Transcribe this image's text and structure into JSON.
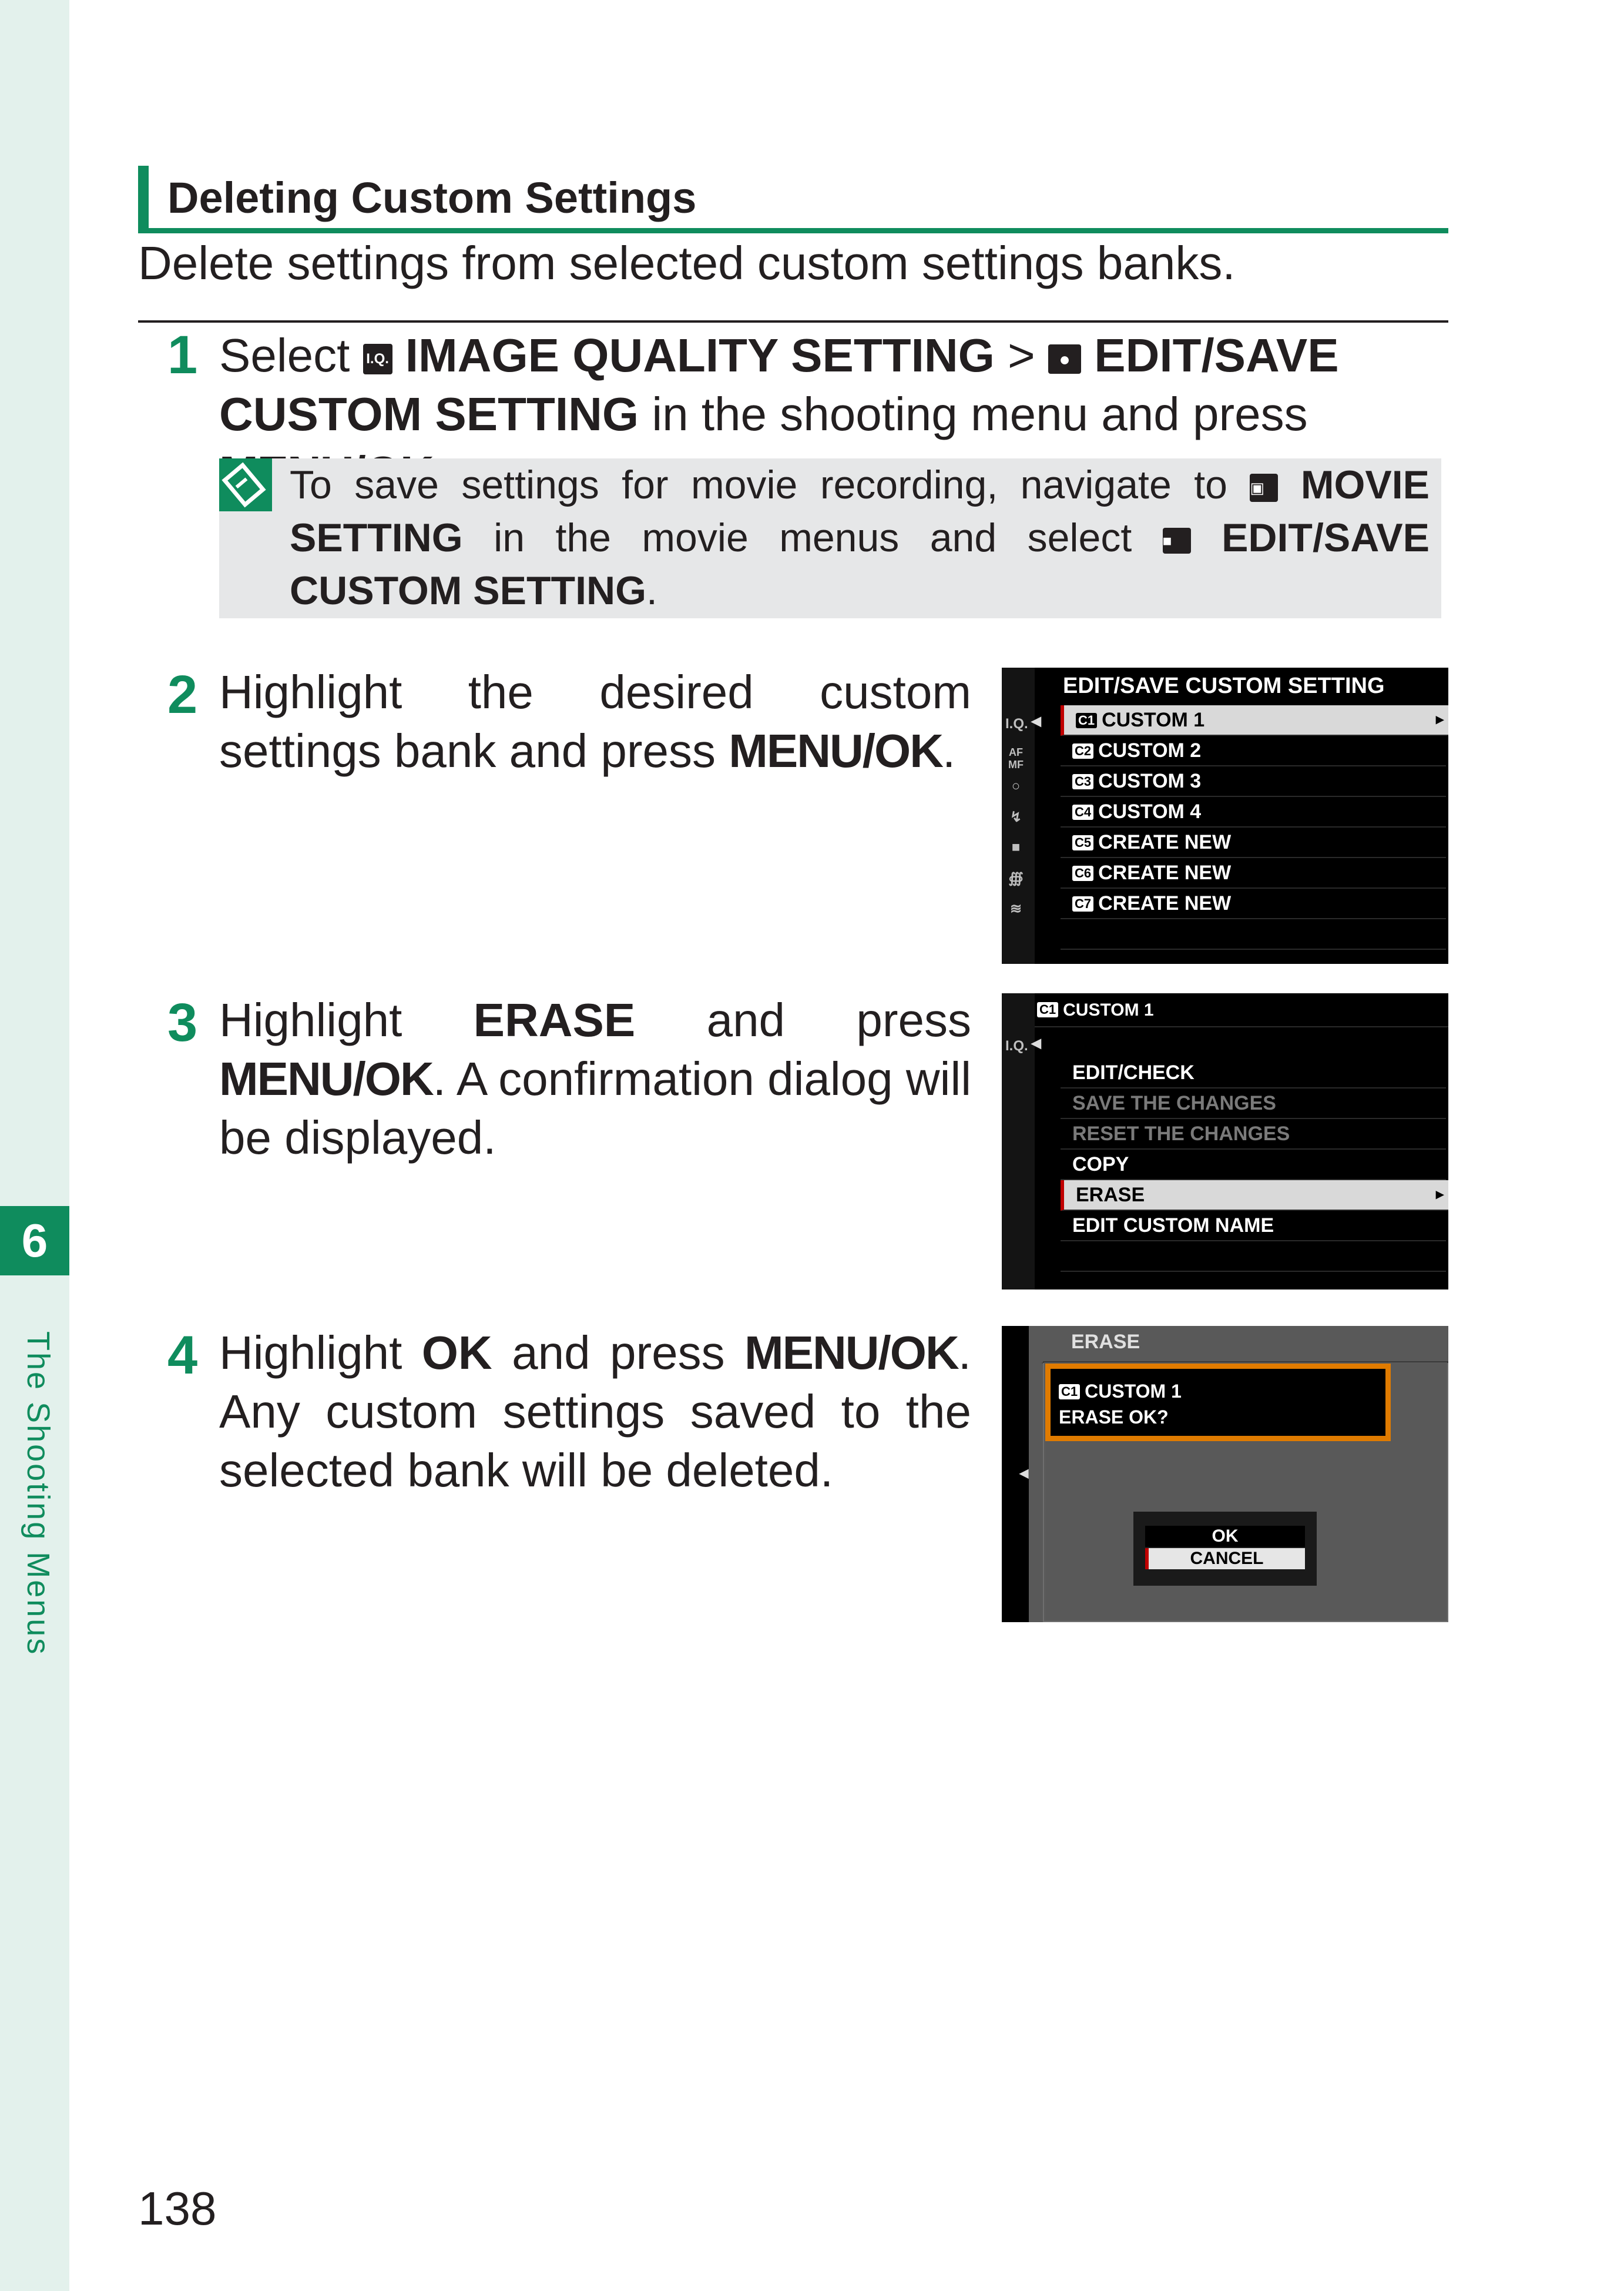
{
  "chapter": {
    "number": "6",
    "label": "The Shooting Menus"
  },
  "heading": "Deleting Custom Settings",
  "intro": "Delete settings from selected custom settings banks.",
  "steps": {
    "s1": {
      "number": "1",
      "t1": "Select ",
      "icon1": "I.Q.",
      "b1": " IMAGE QUALITY SETTING",
      "t2": " > ",
      "b2": " EDIT/SAVE CUSTOM SETTING",
      "t3": " in the shooting menu and press ",
      "key": "MENU/OK",
      "t4": "."
    },
    "note": {
      "t1": "To save settings for movie recording, navigate to ",
      "b1": " MOVIE SETTING",
      "t2": " in the movie menus and select ",
      "b2": " EDIT/SAVE CUSTOM SETTING",
      "t3": "."
    },
    "s2": {
      "number": "2",
      "t1": "Highlight the desired custom settings bank and press ",
      "key": "MENU/OK",
      "t2": "."
    },
    "s3": {
      "number": "3",
      "t1": "Highlight ",
      "b1": "ERASE",
      "t2": " and press ",
      "key": "MENU/OK",
      "t3": ". A confirmation dialog will be displayed."
    },
    "s4": {
      "number": "4",
      "t1": "Highlight ",
      "b1": "OK",
      "t2": " and press ",
      "key": "MENU/OK",
      "t3": ". Any custom settings saved to the selected bank will be deleted."
    }
  },
  "screen1": {
    "title": "EDIT/SAVE CUSTOM SETTING",
    "rail": [
      "I.Q.",
      "AF MF",
      "camera-icon",
      "flash-icon",
      "movie-icon",
      "wrench-icon",
      "wave-icon"
    ],
    "items": [
      {
        "badge": "C1",
        "label": "CUSTOM 1"
      },
      {
        "badge": "C2",
        "label": "CUSTOM 2"
      },
      {
        "badge": "C3",
        "label": "CUSTOM 3"
      },
      {
        "badge": "C4",
        "label": "CUSTOM 4"
      },
      {
        "badge": "C5",
        "label": "CREATE NEW"
      },
      {
        "badge": "C6",
        "label": "CREATE NEW"
      },
      {
        "badge": "C7",
        "label": "CREATE NEW"
      }
    ]
  },
  "screen2": {
    "badge": "C1",
    "title": "CUSTOM 1",
    "rail": "I.Q.",
    "items": [
      "EDIT/CHECK",
      "SAVE THE CHANGES",
      "RESET THE CHANGES",
      "COPY",
      "ERASE",
      "EDIT CUSTOM NAME"
    ]
  },
  "screen3": {
    "title": "ERASE",
    "badge": "C1",
    "line1": "CUSTOM 1",
    "line2": "ERASE OK?",
    "ok": "OK",
    "cancel": "CANCEL"
  },
  "page_number": "138",
  "colors": {
    "accent": "#0f8c5d",
    "sidebar": "#e3f1ec",
    "note_bg": "#e6e7e8",
    "dialog_border": "#e07b00"
  }
}
